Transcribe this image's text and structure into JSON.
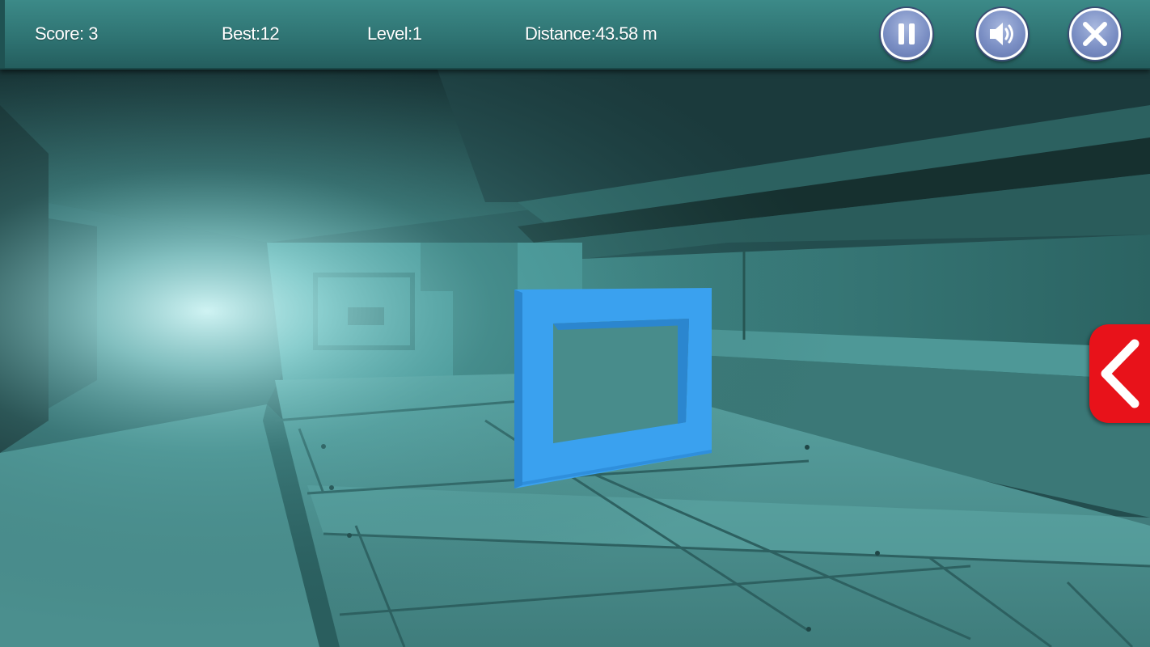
{
  "hud": {
    "score": "Score: 3",
    "best": "Best:12",
    "level": "Level:1",
    "distance": "Distance:43.58 m"
  },
  "controls": {
    "pause_icon": "pause-icon",
    "sound_icon": "speaker-icon",
    "close_icon": "close-icon",
    "steer_icon": "chevron-left-icon"
  },
  "colors": {
    "hud_bar": "#2f7473",
    "button_fill": "#7b8fc4",
    "steer_button": "#e8121a",
    "gate": "#3aa1ef",
    "tunnel": "#4d9393"
  }
}
